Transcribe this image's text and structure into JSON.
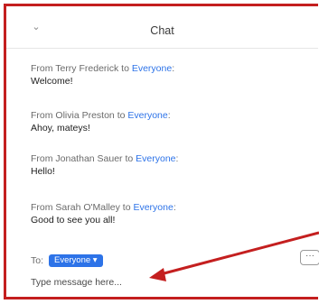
{
  "chat": {
    "title": "Chat",
    "collapse_glyph": "⌄",
    "messages": [
      {
        "sender": "From Terry Frederick to ",
        "recipient": "Everyone",
        "suffix": ":",
        "text": "Welcome!"
      },
      {
        "sender": "From Olivia Preston to ",
        "recipient": "Everyone",
        "suffix": ":",
        "text": "Ahoy, mateys!"
      },
      {
        "sender": "From Jonathan Sauer to ",
        "recipient": "Everyone",
        "suffix": ":",
        "text": "Hello!"
      },
      {
        "sender": "From Sarah O'Malley to ",
        "recipient": "Everyone",
        "suffix": ":",
        "text": "Good to see you all!"
      }
    ],
    "to_label": "To:",
    "recipient_select": "Everyone ▾",
    "more_glyph": "···",
    "input_placeholder": "Type message here..."
  },
  "colors": {
    "frame_border": "#c41f1f",
    "accent": "#2d73e8",
    "annotation_arrow": "#c41f1f"
  }
}
